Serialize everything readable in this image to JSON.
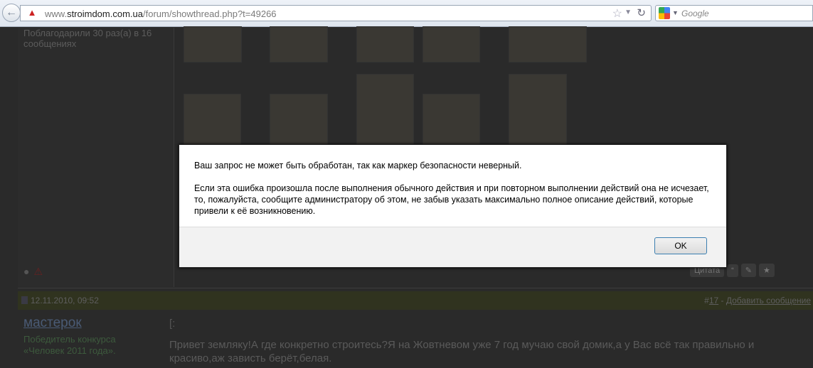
{
  "browser": {
    "url_prefix": "www.",
    "url_domain": "stroimdom.com.ua",
    "url_path": "/forum/showthread.php?t=49266",
    "search_placeholder": "Google"
  },
  "forum": {
    "thanks_text": "Поблагодарили 30 раз(а) в 16 сообщениях",
    "quote_button": "Цитата",
    "post": {
      "date": "12.11.2010, 09:52",
      "number_prefix": "#",
      "number": "17",
      "add_link": "Добавить сообщение",
      "author": "мастерок",
      "author_title": "Победитель конкурса «Человек 2011 года».",
      "marker": "[:",
      "body": "Привет земляку!А где конкретно строитесь?Я на Жовтневом уже 7 год мучаю свой домик,а у Вас всё так правильно и красиво,аж зависть берёт,белая."
    }
  },
  "dialog": {
    "line1": "Ваш запрос не может быть обработан, так как маркер безопасности неверный.",
    "line2": "Если эта ошибка произошла после выполнения обычного действия и при повторном выполнении действий она не исчезает, то, пожалуйста, сообщите администратору об этом, не забыв указать максимально полное описание действий, которые привели к её возникновению.",
    "ok_label": "OK"
  },
  "colors": {
    "overlay": "#000000",
    "ok_border": "#3c7fb1"
  }
}
